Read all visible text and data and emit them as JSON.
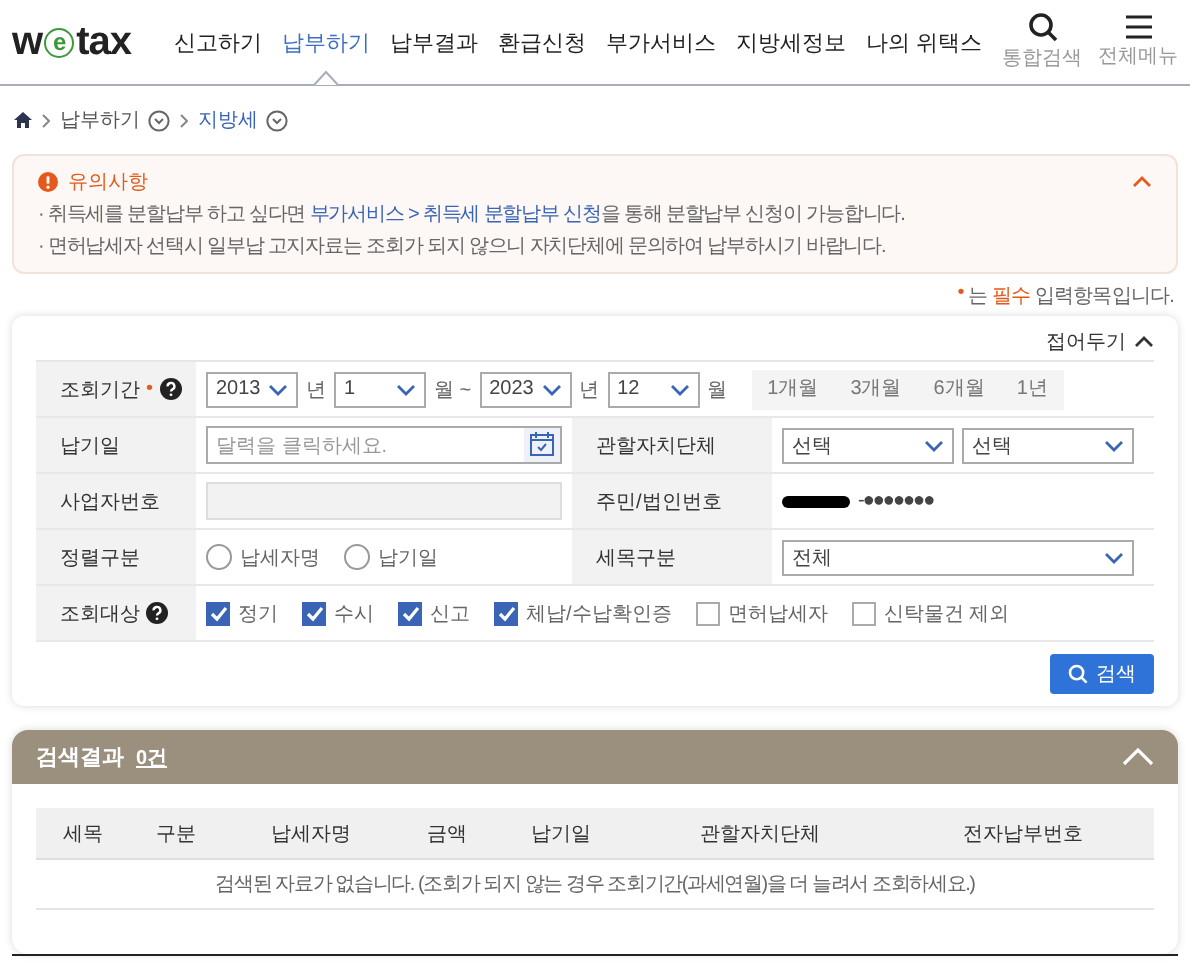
{
  "logo": {
    "text": "wetax"
  },
  "nav": {
    "items": [
      {
        "label": "신고하기",
        "selected": false
      },
      {
        "label": "납부하기",
        "selected": true
      },
      {
        "label": "납부결과",
        "selected": false
      },
      {
        "label": "환급신청",
        "selected": false
      },
      {
        "label": "부가서비스",
        "selected": false
      },
      {
        "label": "지방세정보",
        "selected": false
      },
      {
        "label": "나의 위택스",
        "selected": false
      }
    ],
    "tools": [
      {
        "label": "통합검색",
        "kind": "search"
      },
      {
        "label": "전체메뉴",
        "kind": "menu"
      }
    ]
  },
  "breadcrumb": [
    {
      "label": "납부하기",
      "selected": false
    },
    {
      "label": "지방세",
      "selected": true
    }
  ],
  "notice": {
    "title": "유의사항",
    "expanded": true,
    "lines": [
      "· 취득세를 분할납부 하고 싶다면 **부가서비스 > 취득세 분할납부 신청**을 통해 분할납부 신청이 가능합니다.",
      "· 면허납세자 선택시 일부납 고지자료는 조회가 되지 않으니 자치단체에 문의하여 납부하시기 바랍니다."
    ]
  },
  "required_note": {
    "mark": "•",
    "text": "는 **필수** 입력항목입니다."
  },
  "search_form": {
    "collapse_label": "접어두기",
    "expanded": true,
    "period": {
      "label": "조회기간",
      "required_mark": "•",
      "help": true,
      "selects": [
        {
          "value": "2013",
          "unit": "년"
        },
        {
          "value": "1",
          "unit": "월 ~"
        },
        {
          "value": "2023",
          "unit": "년"
        },
        {
          "value": "12",
          "unit": "월"
        }
      ],
      "presets": [
        "1개월",
        "3개월",
        "6개월",
        "1년"
      ]
    },
    "rows": [
      {
        "cells": [
          {
            "label": "납기일",
            "kind": "date",
            "placeholder": "달력을 클릭하세요."
          },
          {
            "label": "관할자치단체",
            "kind": "select",
            "values": [
              "선택",
              "선택"
            ]
          }
        ]
      },
      {
        "cells": [
          {
            "label": "사업자번호",
            "kind": "disabled"
          },
          {
            "label": "주민/법인번호",
            "kind": "masked",
            "value": "-●●●●●●●"
          }
        ]
      },
      {
        "cells": [
          {
            "label": "정렬구분",
            "kind": "radio",
            "options": [
              {
                "label": "납세자명",
                "selected": false
              },
              {
                "label": "납기일",
                "selected": false
              }
            ]
          },
          {
            "label": "세목구분",
            "kind": "select",
            "values": [
              "전체"
            ]
          }
        ]
      }
    ],
    "targets": {
      "label": "조회대상",
      "help": true,
      "options": [
        {
          "label": "정기",
          "checked": true
        },
        {
          "label": "수시",
          "checked": true
        },
        {
          "label": "신고",
          "checked": true
        },
        {
          "label": "체납/수납확인증",
          "checked": true
        },
        {
          "label": "면허납세자",
          "checked": false
        },
        {
          "label": "신탁물건 제외",
          "checked": false
        }
      ]
    },
    "search_button": "검색"
  },
  "results": {
    "title": "검색결과",
    "count": "0건",
    "expanded": true,
    "columns": [
      "세목",
      "구분",
      "납세자명",
      "금액",
      "납기일",
      "관할자치단체",
      "전자납부번호"
    ],
    "empty_message": "검색된 자료가 없습니다. (조회가 되지 않는 경우 조회기간(과세연월)을 더 늘려서 조회하세요.)"
  }
}
